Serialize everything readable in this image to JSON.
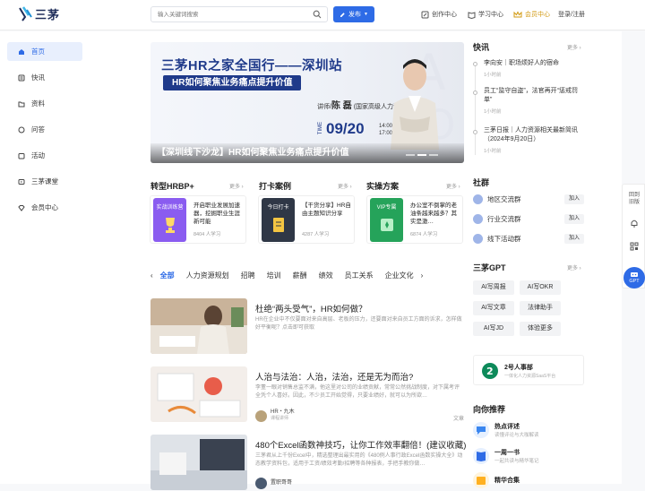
{
  "brand": {
    "name": "三茅"
  },
  "search": {
    "placeholder": "输入关键词搜索"
  },
  "header": {
    "publish_label": "发布",
    "nav": [
      {
        "label": "创作中心",
        "icon": "edit-icon"
      },
      {
        "label": "学习中心",
        "icon": "book-icon"
      },
      {
        "label": "会员中心",
        "icon": "crown-icon"
      },
      {
        "label": "登录/注册"
      }
    ]
  },
  "sidebar": {
    "items": [
      {
        "label": "首页",
        "icon": "home-icon",
        "active": true
      },
      {
        "label": "快讯",
        "icon": "news-icon"
      },
      {
        "label": "资料",
        "icon": "folder-icon"
      },
      {
        "label": "问答",
        "icon": "qa-icon"
      },
      {
        "label": "活动",
        "icon": "activity-icon"
      },
      {
        "label": "三茅课堂",
        "icon": "video-icon"
      },
      {
        "label": "会员中心",
        "icon": "member-icon"
      }
    ]
  },
  "banner": {
    "title": "三茅HR之家全国行——深圳站",
    "subtitle": "HR如何聚焦业务痛点提升价值",
    "lecturer_prefix": "讲师/",
    "lecturer_name": "陈 磊",
    "lecturer_desc": "(国家高级人力资源管理师)",
    "date": "09/20",
    "time_start": "14:00",
    "time_end": "17:00",
    "time_label": "TIME",
    "caption": "【深圳线下沙龙】HR如何聚焦业务痛点提升价值"
  },
  "sections": [
    {
      "title": "转型HRBP+",
      "more": "更多 ›",
      "course": {
        "thumb_text": "实战训练营",
        "title": "开启职业发展加速器，挖掘职业生涯新可能",
        "meta": "8404 人学习",
        "color": "#8a5cf0"
      }
    },
    {
      "title": "打卡案例",
      "more": "更多 ›",
      "course": {
        "thumb_text": "今日打卡",
        "title": "【干货分享】HR自由主题知识分享",
        "meta": "4287 人学习",
        "color": "#2f3746"
      }
    },
    {
      "title": "实操方案",
      "more": "更多 ›",
      "course": {
        "thumb_text": "VIP专属",
        "title": "办公室不倒掌的老油条越来越多？其实是激…",
        "meta": "6874 人学习",
        "color": "#25a35a"
      }
    }
  ],
  "tabs": [
    "全部",
    "人力资源规划",
    "招聘",
    "培训",
    "薪酬",
    "绩效",
    "员工关系",
    "企业文化"
  ],
  "feed": [
    {
      "title": "杜绝“两头受气”，HR如何做？",
      "desc": "HR在企业中不仅要面对来自高层、老板的压力，还要面对来自员工方面的诉求，怎样做好平衡呢？点击即可获取",
      "author": "",
      "author_sub": "",
      "tag": ""
    },
    {
      "title": "人治与法治：人治，法治，还是无为而治?",
      "desc": "李董一眼对销售总监不满，他这里对公司的业绩贡献，常常公然挑战制度，对下属考评全凭个人喜好。因此，不少员工开始觉得，只要业绩好，就可以为所欲…",
      "author": "HR・九木",
      "author_sub": "课程讲师",
      "tag": "文章"
    },
    {
      "title": "480个Excel函数神技巧，让你工作效率翻倍！(建议收藏)π",
      "desc": "三茅君从上千份Excel中，精选整理出最实用的《480例人事行政Excel函数实操大全》动态教学资料包，适用于工资/绩效考勤/招聘等各种报表，手把手教你做…",
      "author": "置职哥哥",
      "author_sub": "",
      "tag": ""
    }
  ],
  "right": {
    "flash": {
      "title": "快讯",
      "more": "更多 ›",
      "items": [
        {
          "text": "李向安｜职场烦好人的宿命",
          "time": "1小时前"
        },
        {
          "text": "员工“监守自盗”，法官再开“惩戒罚单”",
          "time": "1小时前"
        },
        {
          "text": "三茅日报｜人力资源相关最新简讯（2024年9月20日）",
          "time": "1小时前"
        }
      ]
    },
    "community": {
      "title": "社群",
      "join_label": "加入",
      "groups": [
        "地区交流群",
        "行业交流群",
        "线下活动群"
      ]
    },
    "gpt": {
      "title": "三茅GPT",
      "more": "更多 ›",
      "items": [
        "AI写周报",
        "AI写OKR",
        "AI写文章",
        "法律助手",
        "AI写JD",
        "体验更多"
      ]
    },
    "ad": {
      "title": "2号人事部",
      "sub": "一体化人力资源SaaS平台"
    },
    "recommend": {
      "title": "向你推荐",
      "items": [
        {
          "title": "热点评述",
          "sub": "读懂评论与大咖解读",
          "color": "#3a86f0"
        },
        {
          "title": "一周一书",
          "sub": "一起共读与精华笔记",
          "color": "#2e6be6"
        },
        {
          "title": "精华合集",
          "sub": "",
          "color": "#ffb020"
        }
      ]
    }
  },
  "floatbar": {
    "top_label": "回到旧版",
    "gpt_label": "GPT"
  },
  "colors": {
    "accent": "#2e6be6",
    "gold": "#d29a12",
    "banner_blue": "#1f3a8a"
  }
}
